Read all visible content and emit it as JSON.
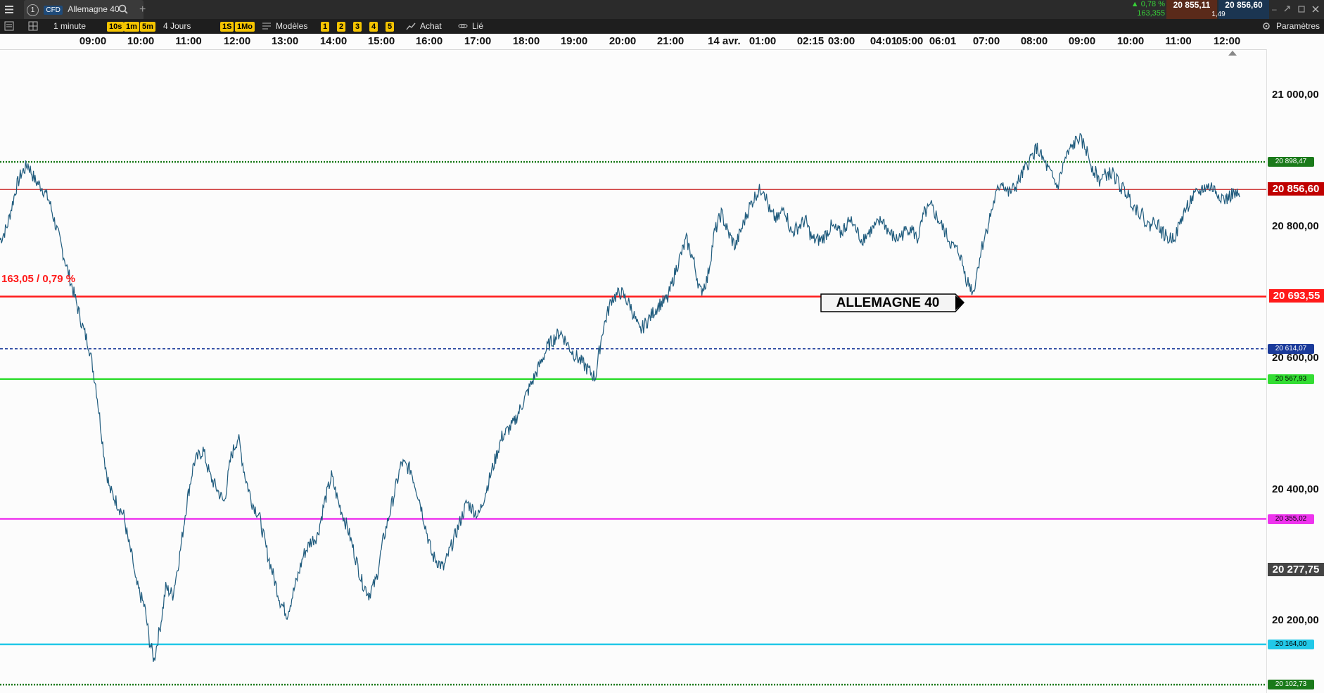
{
  "app": {
    "tab_number": "1",
    "instrument_type": "CFD",
    "instrument_name": "Allemagne 40",
    "change_pct": "▲ 0,78 %",
    "change_abs": "163,355",
    "bid": "20 855,11",
    "ask": "20 856,60",
    "spread": "1,49"
  },
  "toolbar": {
    "interval": "1 minute",
    "quick_intervals": [
      "10s",
      "1m",
      "5m"
    ],
    "range": "4 Jours",
    "range_quick": [
      "1S",
      "1Mo"
    ],
    "models_label": "Modèles",
    "model_slots": [
      "1",
      "2",
      "3",
      "4",
      "5"
    ],
    "buy_label": "Achat",
    "linked_label": "Lié",
    "settings_label": "Paramètres"
  },
  "icons": [
    "menu-icon",
    "search-icon",
    "add-tab-icon",
    "list-icon",
    "layout-icon",
    "templates-icon",
    "buy-icon",
    "link-icon",
    "settings-icon",
    "minimize-icon",
    "restore-icon",
    "popout-icon",
    "close-icon"
  ],
  "colors": {
    "price_line": "#1f5b7d",
    "resistance": "#1a7a1a",
    "current_price": "#c00000",
    "red_level": "#ff1a1a",
    "blue_level": "#1a3a9a",
    "green_level": "#33dd33",
    "magenta_level": "#ee33ee",
    "cyan_level": "#22c8e8"
  },
  "chart_data": {
    "type": "line",
    "title": "",
    "annotation_label": "ALLEMAGNE 40",
    "change_label": "163,05 / 0,79 %",
    "x_tick_labels": [
      "09:00",
      "10:00",
      "11:00",
      "12:00",
      "13:00",
      "14:00",
      "15:00",
      "16:00",
      "17:00",
      "18:00",
      "19:00",
      "20:00",
      "21:00",
      "14 avr.",
      "01:00",
      "02:15",
      "03:00",
      "04:01",
      "05:00",
      "06:01",
      "07:00",
      "08:00",
      "09:00",
      "10:00",
      "11:00",
      "12:00"
    ],
    "y_tick_labels": [
      "21 000,00",
      "20 800,00",
      "20 600,00",
      "20 400,00",
      "20 200,00"
    ],
    "ylim": [
      20090,
      21070
    ],
    "levels": [
      {
        "value": 20898.47,
        "label": "20 898,47",
        "style": "dotted",
        "color": "#1a7a1a"
      },
      {
        "value": 20856.6,
        "label": "20 856,60",
        "style": "current",
        "color": "#c00000"
      },
      {
        "value": 20693.55,
        "label": "20 693,55",
        "style": "solid",
        "color": "#ff1a1a"
      },
      {
        "value": 20614.07,
        "label": "20 614,07",
        "style": "dashed",
        "color": "#1a3a9a"
      },
      {
        "value": 20567.93,
        "label": "20 567,93",
        "style": "solid",
        "color": "#33dd33"
      },
      {
        "value": 20355.02,
        "label": "20 355,02",
        "style": "solid",
        "color": "#ee33ee"
      },
      {
        "value": 20277.75,
        "label": "20 277,75",
        "style": "box",
        "color": "#444444"
      },
      {
        "value": 20164.0,
        "label": "20 164,00",
        "style": "solid",
        "color": "#22c8e8"
      },
      {
        "value": 20102.73,
        "label": "20 102,73",
        "style": "dotted",
        "color": "#1a7a1a"
      }
    ],
    "series": [
      {
        "x": [
          0,
          1,
          3,
          5,
          7,
          9,
          12,
          15,
          18,
          21,
          24,
          27,
          30,
          33,
          36,
          38,
          39,
          41,
          43,
          45,
          47,
          50,
          53,
          55,
          57,
          58,
          60,
          62,
          64,
          66,
          69,
          71,
          74,
          77,
          80,
          83,
          87,
          90,
          93,
          96,
          99,
          102,
          105,
          108,
          111,
          114,
          117,
          120,
          123,
          127,
          130,
          133,
          136,
          139,
          142,
          145,
          149,
          152,
          155,
          158,
          161,
          164,
          168,
          172,
          176,
          180,
          185,
          190,
          195,
          200,
          205,
          210,
          215,
          220,
          225,
          230,
          235,
          240,
          245,
          250,
          255,
          258,
          262,
          266,
          270,
          274,
          278,
          282,
          286,
          290,
          294,
          297,
          300,
          303,
          306,
          309,
          312,
          315,
          318,
          321,
          324,
          327,
          330,
          333,
          336,
          339,
          342,
          345,
          348,
          352,
          356,
          360,
          364
        ],
        "y": [
          20780,
          20785,
          20800,
          20830,
          20860,
          20880,
          20895,
          20870,
          20860,
          20840,
          20800,
          20760,
          20720,
          20680,
          20640,
          20620,
          20600,
          20560,
          20500,
          20440,
          20400,
          20380,
          20360,
          20320,
          20290,
          20260,
          20240,
          20220,
          20170,
          20140,
          20200,
          20250,
          20240,
          20300,
          20380,
          20440,
          20460,
          20420,
          20400,
          20380,
          20450,
          20480,
          20420,
          20380,
          20360,
          20310,
          20270,
          20230,
          20210,
          20260,
          20300,
          20320,
          20330,
          20380,
          20420,
          20380,
          20340,
          20300,
          20260,
          20240,
          20260,
          20320,
          20380,
          20440,
          20430,
          20380,
          20300,
          20280,
          20330,
          20380,
          20360,
          20420,
          20480,
          20500,
          20540,
          20580,
          20620,
          20640,
          20610,
          20590,
          20570,
          20640,
          20690,
          20700,
          20680,
          20640,
          20660,
          20680,
          20690,
          20740,
          20780,
          20750,
          20700,
          20720,
          20790,
          20820,
          20790,
          20770,
          20800,
          20830,
          20850,
          20860,
          20820,
          20810,
          20830,
          20790,
          20800,
          20810,
          20780,
          20780,
          20800,
          20790,
          20810
        ]
      },
      {
        "x": [
          364,
          366,
          369,
          372,
          375,
          378,
          381,
          384,
          387,
          390,
          393,
          396,
          399,
          402,
          405,
          408,
          411,
          414,
          417,
          420,
          423,
          426,
          429,
          432,
          435,
          438,
          441,
          444,
          447,
          450,
          453,
          456,
          459,
          462,
          465,
          468,
          471,
          474,
          477,
          480,
          483,
          486,
          489,
          492,
          495,
          498,
          501,
          504,
          507,
          510,
          513,
          516,
          519,
          522,
          525,
          528,
          531
        ],
        "y": [
          20810,
          20800,
          20780,
          20790,
          20800,
          20810,
          20790,
          20780,
          20790,
          20800,
          20780,
          20820,
          20830,
          20810,
          20790,
          20770,
          20760,
          20720,
          20700,
          20760,
          20800,
          20840,
          20870,
          20850,
          20860,
          20880,
          20900,
          20920,
          20900,
          20880,
          20860,
          20900,
          20920,
          20935,
          20920,
          20890,
          20870,
          20880,
          20880,
          20860,
          20850,
          20830,
          20820,
          20800,
          20810,
          20790,
          20780,
          20790,
          20820,
          20840,
          20850,
          20860,
          20860,
          20850,
          20840,
          20850,
          20845
        ]
      }
    ],
    "x_span": [
      0,
      531
    ]
  }
}
